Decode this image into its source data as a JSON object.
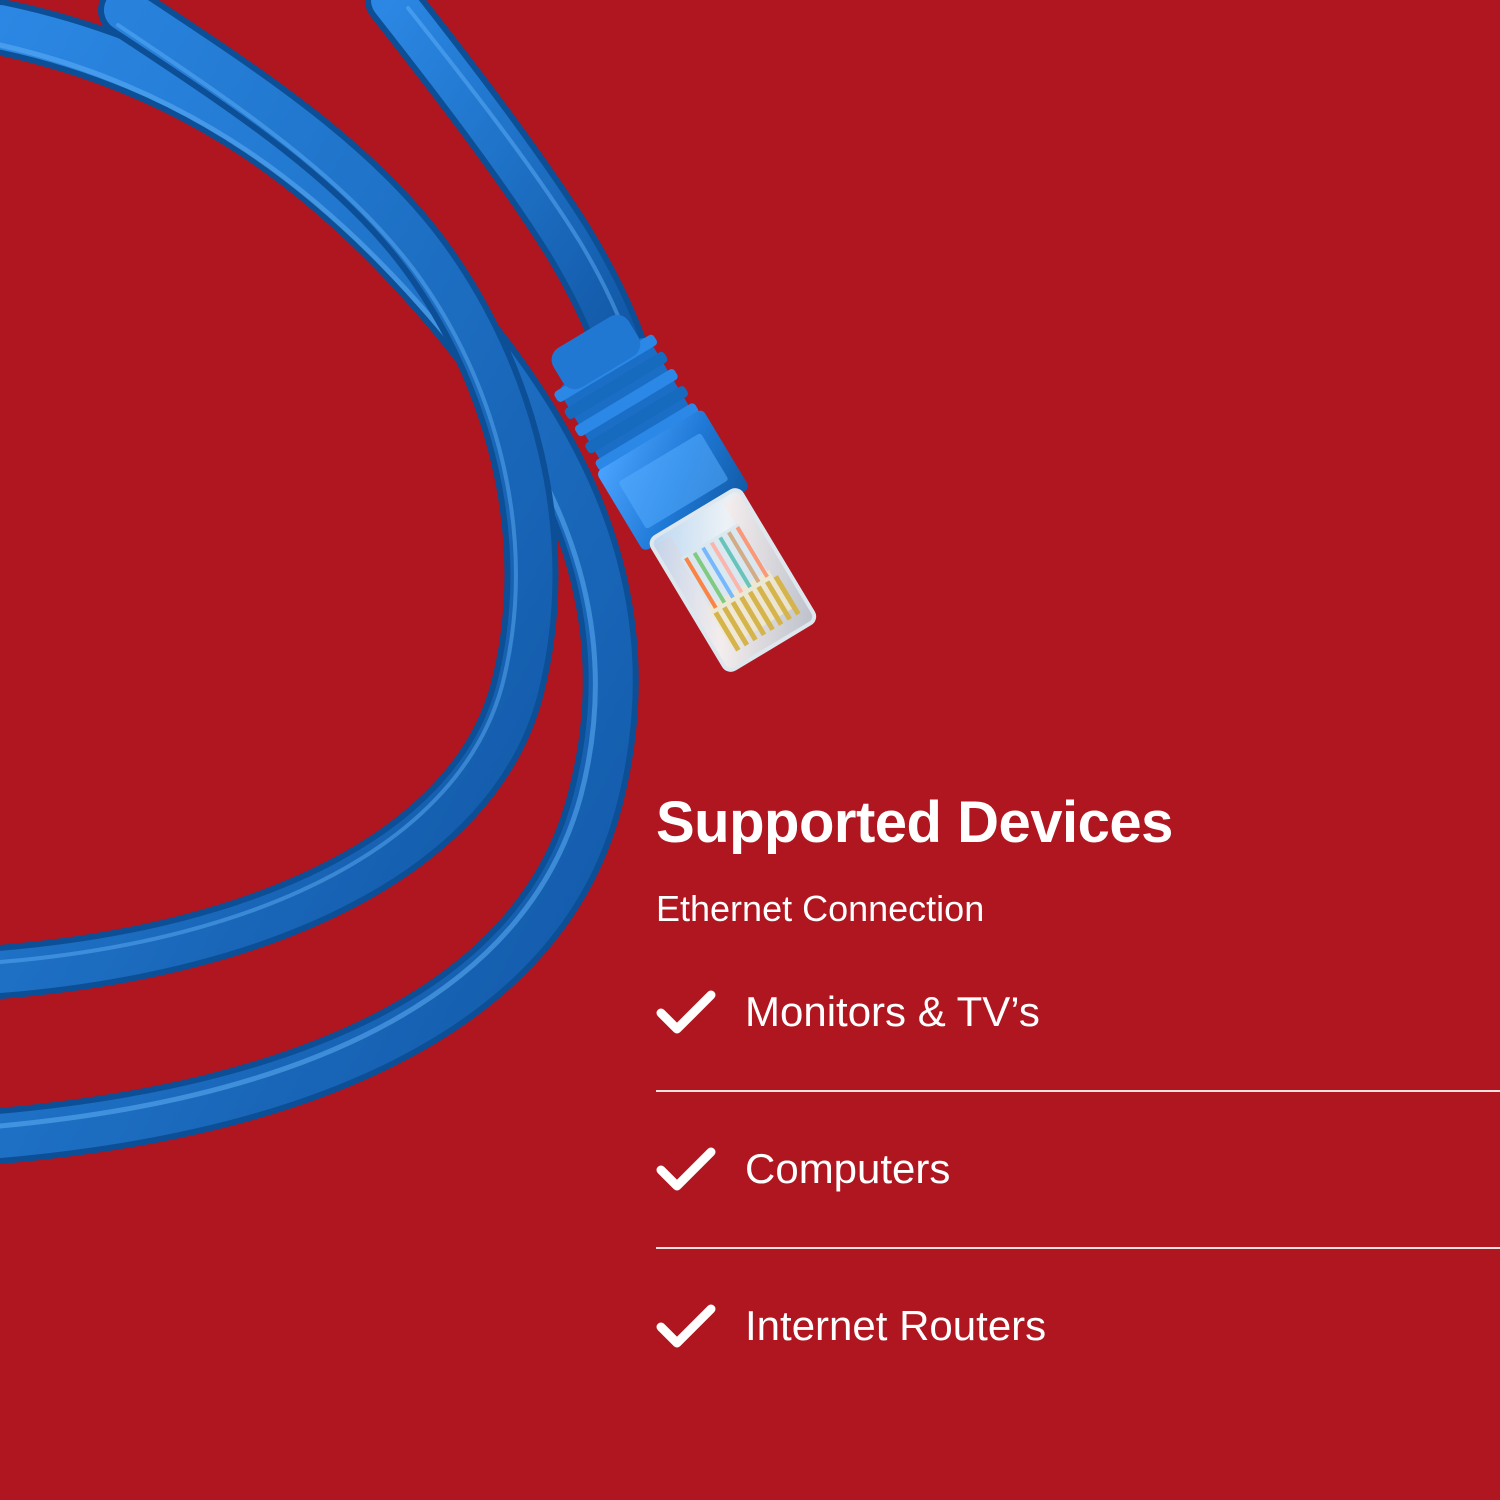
{
  "theme": {
    "background": "#af161f",
    "cable": "#1f73c8",
    "text": "#ffffff"
  },
  "product": {
    "illustration": "ethernet-cable-icon"
  },
  "content": {
    "title": "Supported Devices",
    "subtitle": "Ethernet Connection",
    "items": [
      {
        "label": "Monitors & TV’s",
        "icon": "check-icon"
      },
      {
        "label": "Computers",
        "icon": "check-icon"
      },
      {
        "label": "Internet Routers",
        "icon": "check-icon"
      }
    ]
  }
}
